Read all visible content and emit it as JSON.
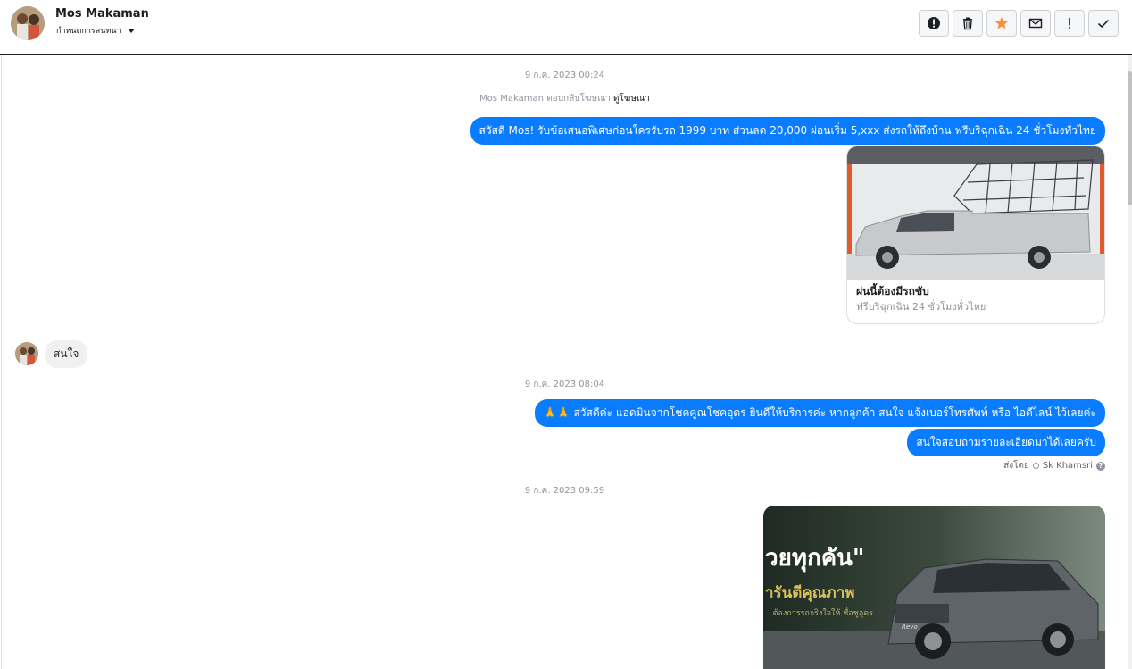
{
  "header": {
    "name": "Mos Makaman",
    "subtitle": "กำหนดการสนทนา"
  },
  "toolbar": {
    "icons": [
      "alert-circle-icon",
      "trash-icon",
      "star-icon",
      "envelope-icon",
      "exclamation-icon",
      "check-icon"
    ],
    "star_color": "#f7923b"
  },
  "thread": {
    "timestamp1": "9 ก.ค. 2023 00:24",
    "reply_note_prefix": "Mos Makaman ตอบกลับโฆษณา",
    "reply_note_link": "ดูโฆษณา",
    "msg1": "สวัสดี Mos! รับข้อเสนอพิเศษก่อนใครรับรถ 1999 บาท ส่วนลด 20,000  ผ่อนเริ่ม 5,xxx ส่งรถให้ถึงบ้าน ฟรีบริฉุกเฉิน 24 ชั่วโมงทั่วไทย",
    "card": {
      "title": "ฝนนี้ต้องมีรถขับ",
      "subtitle": "ฟรีบริฉุกเฉิน 24 ชั่วโมงทั่วไทย"
    },
    "incoming": "สนใจ",
    "timestamp2": "9 ก.ค. 2023 08:04",
    "msg2": "🙏🙏 สวัสดีค่ะ แอดมินจากโชคคูณโชคอุดร ยินดีให้บริการค่ะ หากลูกค้า สนใจ แจ้งเบอร์โทรศัพท์ หรือ ไอดีไลน์ ไว้เลยค่ะ",
    "msg3": "สนใจสอบถามรายละเอียดมาได้เลยครับ",
    "sent_by_label": "ส่งโดย",
    "sent_by_name": "Sk Khamsri",
    "timestamp3": "9 ก.ค. 2023 09:59",
    "photo": {
      "headline": "วยทุกคัน\"",
      "subline": "ารันตีคุณภาพ",
      "small": "...ต้องการรถจริงใจให้ ชื่อชูอุดร",
      "model_badge": "Revo"
    }
  },
  "colors": {
    "bubble_out": "#0a7cff",
    "bubble_in": "#f1f0f0"
  }
}
